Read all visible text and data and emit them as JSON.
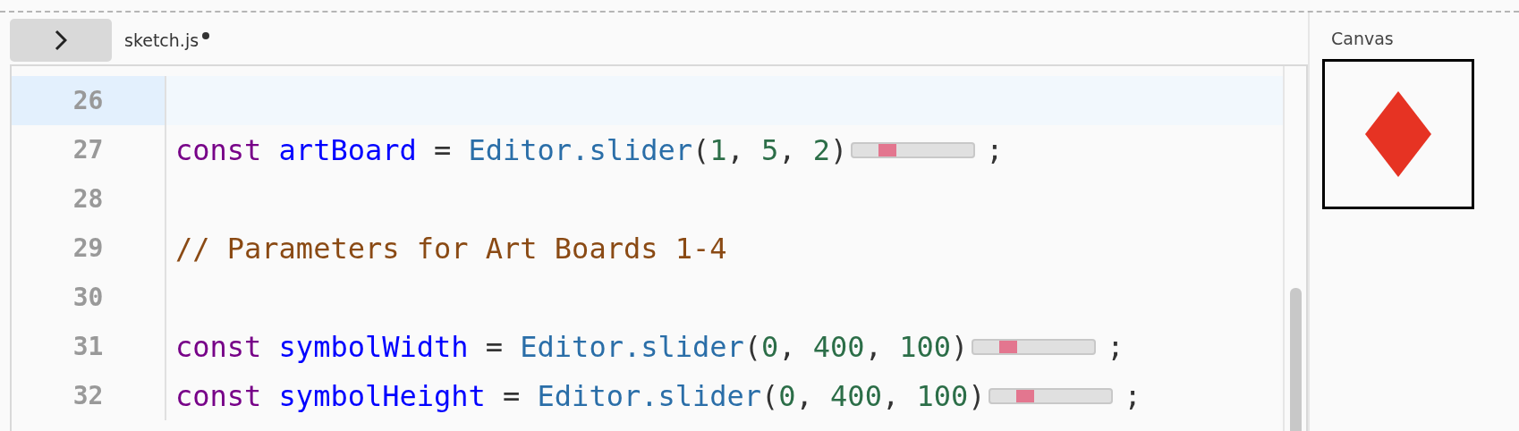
{
  "toggle_button": {
    "expanded": false
  },
  "file_tab": {
    "name": "sketch.js",
    "unsaved": true
  },
  "editor": {
    "lines": [
      {
        "number": "26",
        "active": true
      },
      {
        "number": "27",
        "active": false,
        "tokens": [
          {
            "kind": "keyword",
            "text": "const "
          },
          {
            "kind": "def",
            "text": "artBoard"
          },
          {
            "kind": "punct",
            "text": " = "
          },
          {
            "kind": "prop",
            "text": "Editor.slider"
          },
          {
            "kind": "punct",
            "text": "("
          },
          {
            "kind": "number",
            "text": "1"
          },
          {
            "kind": "punct",
            "text": ", "
          },
          {
            "kind": "number",
            "text": "5"
          },
          {
            "kind": "punct",
            "text": ", "
          },
          {
            "kind": "number",
            "text": "2"
          },
          {
            "kind": "punct",
            "text": ")"
          },
          {
            "kind": "slider",
            "level": 0.25
          },
          {
            "kind": "punct",
            "text": ";"
          }
        ]
      },
      {
        "number": "28",
        "active": false
      },
      {
        "number": "29",
        "active": false,
        "tokens": [
          {
            "kind": "comment",
            "text": "// Parameters for Art Boards 1-4"
          }
        ]
      },
      {
        "number": "30",
        "active": false
      },
      {
        "number": "31",
        "active": false,
        "tokens": [
          {
            "kind": "keyword",
            "text": "const "
          },
          {
            "kind": "def",
            "text": "symbolWidth"
          },
          {
            "kind": "punct",
            "text": " = "
          },
          {
            "kind": "prop",
            "text": "Editor.slider"
          },
          {
            "kind": "punct",
            "text": "("
          },
          {
            "kind": "number",
            "text": "0"
          },
          {
            "kind": "punct",
            "text": ", "
          },
          {
            "kind": "number",
            "text": "400"
          },
          {
            "kind": "punct",
            "text": ", "
          },
          {
            "kind": "number",
            "text": "100"
          },
          {
            "kind": "punct",
            "text": ")"
          },
          {
            "kind": "slider",
            "level": 0.25
          },
          {
            "kind": "punct",
            "text": ";"
          }
        ]
      },
      {
        "number": "32",
        "active": false,
        "tokens": [
          {
            "kind": "keyword",
            "text": "const "
          },
          {
            "kind": "def",
            "text": "symbolHeight"
          },
          {
            "kind": "punct",
            "text": " = "
          },
          {
            "kind": "prop",
            "text": "Editor.slider"
          },
          {
            "kind": "punct",
            "text": "("
          },
          {
            "kind": "number",
            "text": "0"
          },
          {
            "kind": "punct",
            "text": ", "
          },
          {
            "kind": "number",
            "text": "400"
          },
          {
            "kind": "punct",
            "text": ", "
          },
          {
            "kind": "number",
            "text": "100"
          },
          {
            "kind": "punct",
            "text": ")"
          },
          {
            "kind": "slider",
            "level": 0.25
          },
          {
            "kind": "punct",
            "text": ";"
          }
        ]
      }
    ]
  },
  "canvas_panel": {
    "title": "Canvas"
  }
}
